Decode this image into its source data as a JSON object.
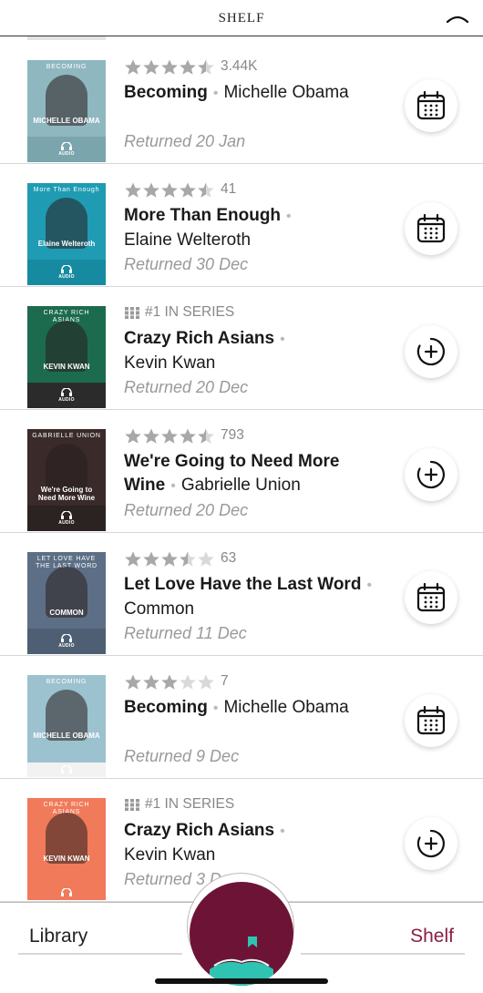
{
  "header": {
    "title": "SHELF"
  },
  "books": [
    {
      "meta_type": "rating",
      "rating": 4.5,
      "rating_count": "3.44K",
      "title": "Becoming",
      "author": "Michelle Obama",
      "author_inline": true,
      "status": "Returned 20 Jan",
      "action": "calendar-icon",
      "cover": {
        "bg": "#8fb7bf",
        "band": "#7aa5ad",
        "top_text": "BECOMING",
        "main_text": "MICHELLE OBAMA",
        "audio": "AUDIO"
      }
    },
    {
      "meta_type": "rating",
      "rating": 4.5,
      "rating_count": "41",
      "title": "More Than Enough",
      "author": "Elaine Welteroth",
      "author_inline": false,
      "status": "Returned 30 Dec",
      "action": "calendar-icon",
      "cover": {
        "bg": "#1f9cb4",
        "band": "#168aa0",
        "top_text": "More Than Enough",
        "main_text": "Elaine Welteroth",
        "audio": "AUDIO"
      }
    },
    {
      "meta_type": "series",
      "series_label": "#1 IN SERIES",
      "title": "Crazy Rich Asians",
      "author": "Kevin Kwan",
      "author_inline": false,
      "status": "Returned 20 Dec",
      "action": "add-icon",
      "cover": {
        "bg": "#1c6b4e",
        "band": "#2b2b2b",
        "top_text": "CRAZY RICH ASIANS",
        "main_text": "KEVIN KWAN",
        "audio": "AUDIO"
      }
    },
    {
      "meta_type": "rating",
      "rating": 4.5,
      "rating_count": "793",
      "title": "We're Going to Need More Wine",
      "author": "Gabrielle Union",
      "author_inline": true,
      "status": "Returned 20 Dec",
      "action": "add-icon",
      "cover": {
        "bg": "#3a2a2a",
        "band": "#2b2222",
        "top_text": "GABRIELLE UNION",
        "main_text": "We're Going to Need More Wine",
        "audio": "AUDIO"
      }
    },
    {
      "meta_type": "rating",
      "rating": 3.5,
      "rating_count": "63",
      "title": "Let Love Have the Last Word",
      "author": "Common",
      "author_inline": false,
      "status": "Returned 11 Dec",
      "action": "calendar-icon",
      "cover": {
        "bg": "#5d6f86",
        "band": "#4e5f74",
        "top_text": "LET LOVE HAVE THE LAST WORD",
        "main_text": "COMMON",
        "audio": "AUDIO"
      }
    },
    {
      "meta_type": "rating",
      "rating": 3,
      "rating_count": "7",
      "title": "Becoming",
      "author": "Michelle Obama",
      "author_inline": true,
      "status": "Returned 9 Dec",
      "action": "calendar-icon",
      "cover": {
        "bg": "#9cc2cf",
        "band": "#f2f2f2",
        "top_text": "BECOMING",
        "main_text": "MICHELLE OBAMA",
        "audio": ""
      }
    },
    {
      "meta_type": "series",
      "series_label": "#1 IN SERIES",
      "title": "Crazy Rich Asians",
      "author": "Kevin Kwan",
      "author_inline": false,
      "status": "Returned 3 D",
      "action": "add-icon",
      "cover": {
        "bg": "#f07a5a",
        "band": "#f07a5a",
        "top_text": "CRAZY RICH ASIANS",
        "main_text": "KEVIN KWAN",
        "audio": ""
      }
    }
  ],
  "bottom_nav": {
    "library": "Library",
    "shelf": "Shelf",
    "active": "Shelf"
  },
  "colors": {
    "accent": "#8a1f44",
    "home_button": "#6d1436",
    "book_icon": "#2fc4b2",
    "star": "#a8a8a8"
  }
}
